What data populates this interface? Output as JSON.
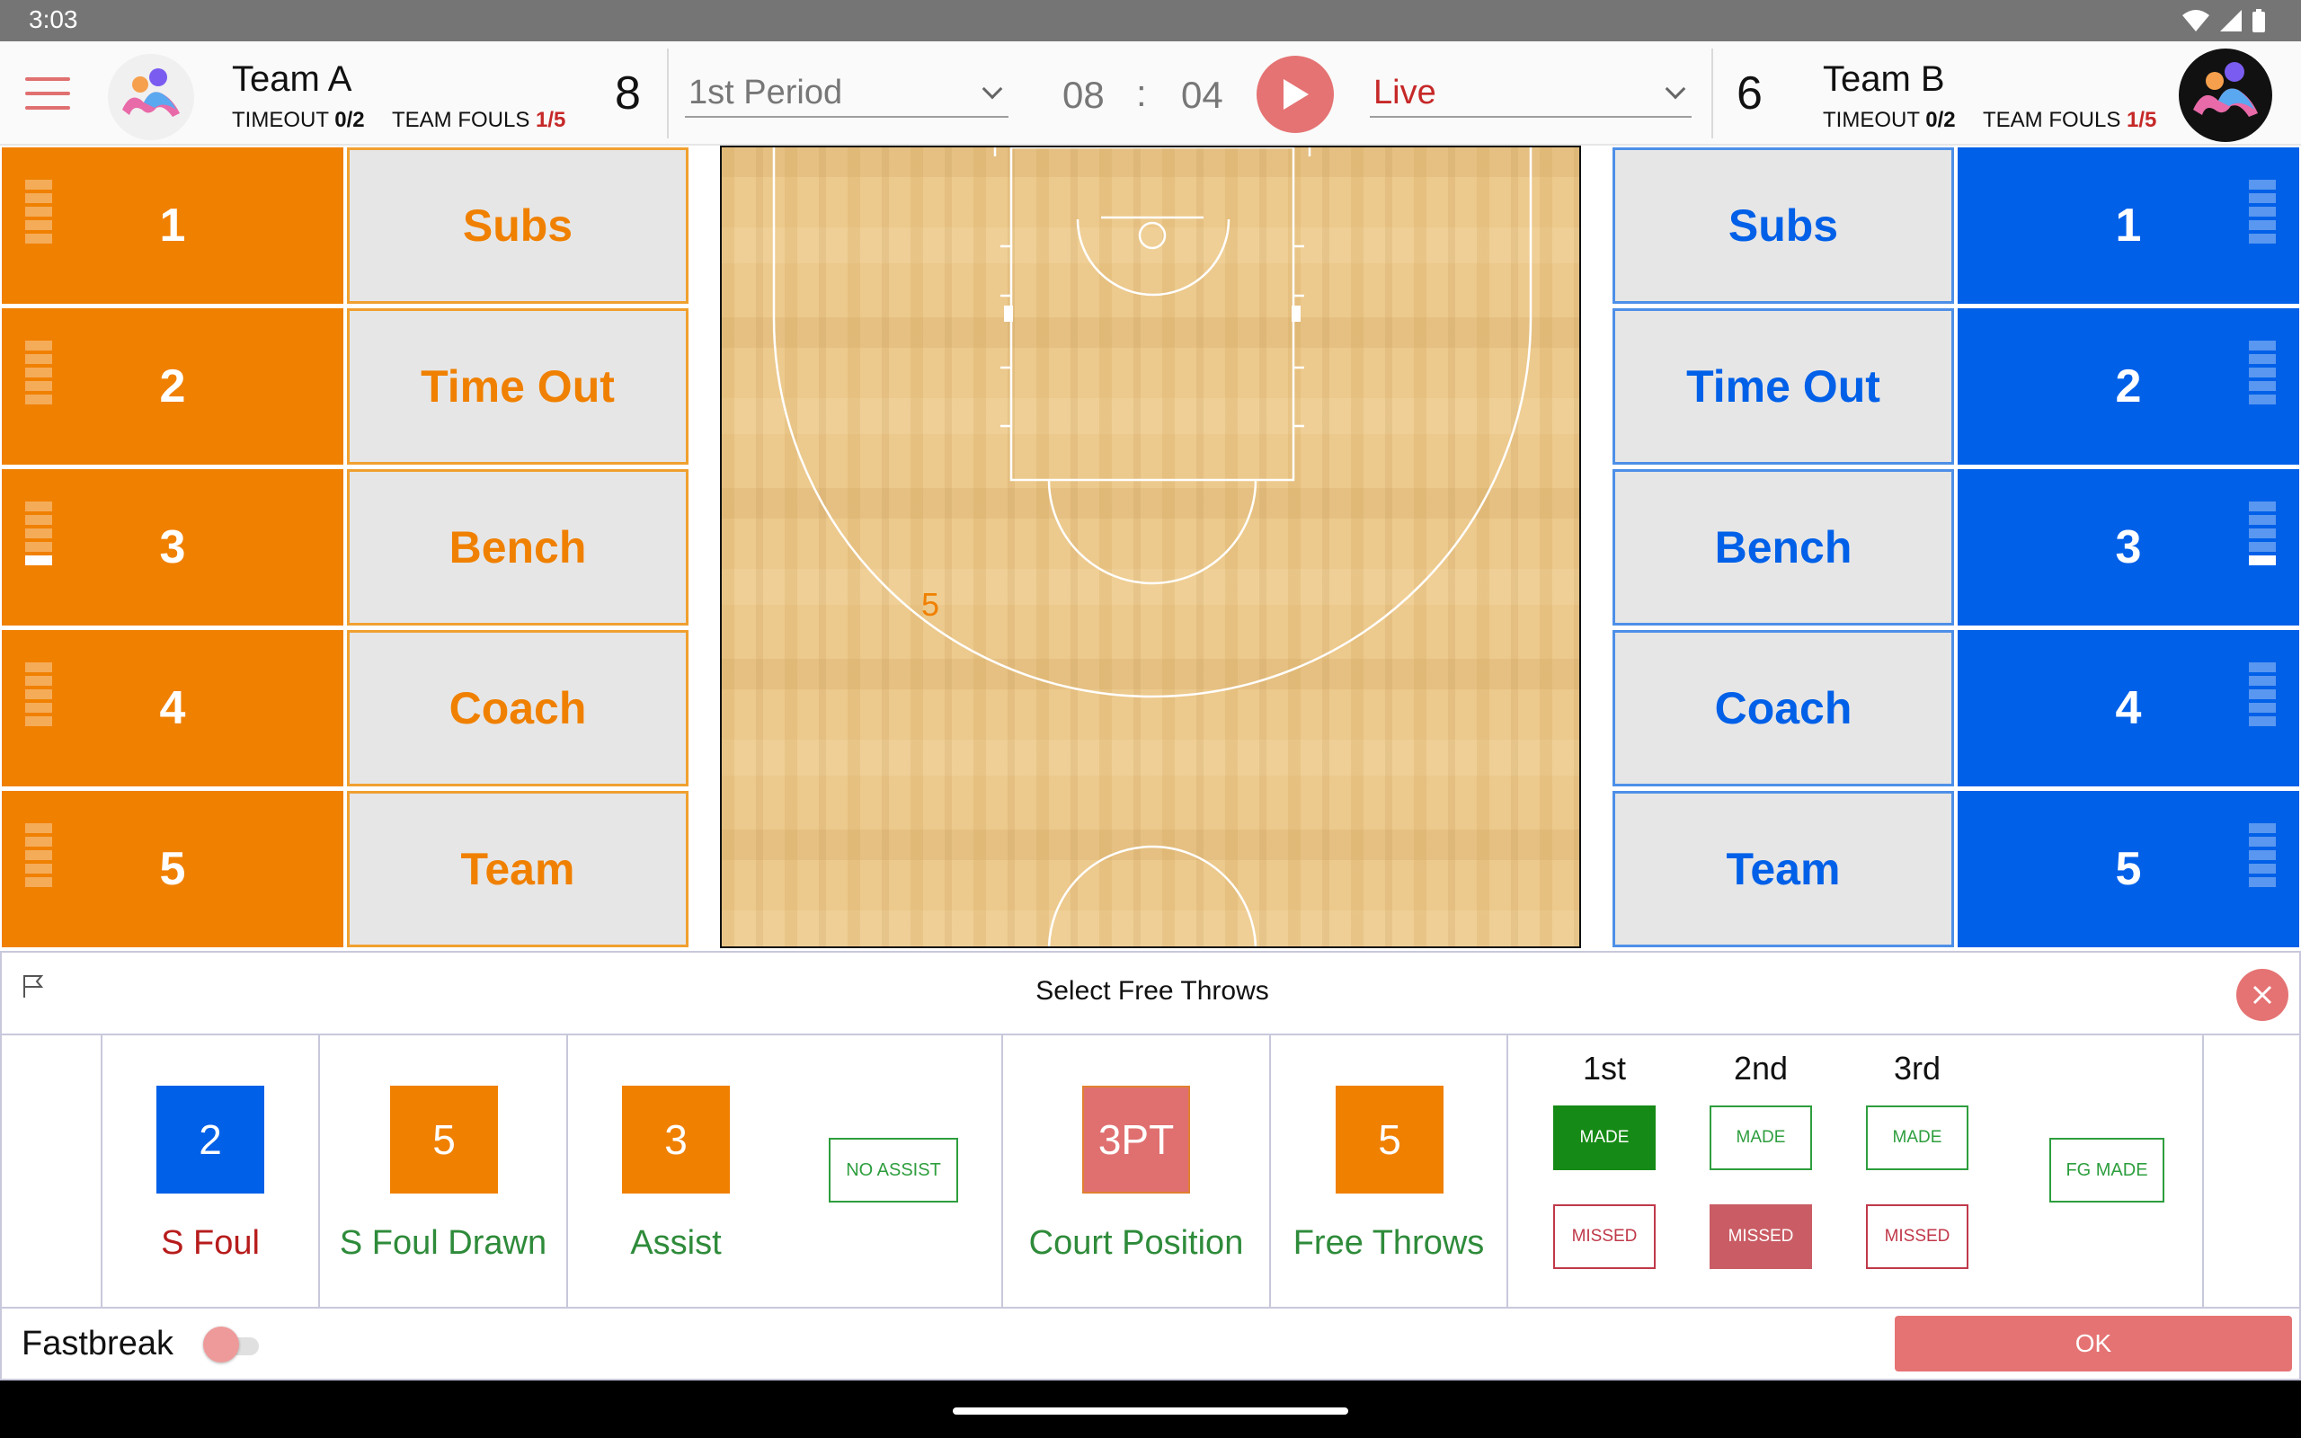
{
  "status": {
    "time": "3:03"
  },
  "header": {
    "team_a": {
      "name": "Team A",
      "timeout_label": "TIMEOUT",
      "timeout_value": "0/2",
      "fouls_label": "TEAM FOULS",
      "fouls_value": "1/5",
      "score": "8"
    },
    "team_b": {
      "name": "Team B",
      "timeout_label": "TIMEOUT",
      "timeout_value": "0/2",
      "fouls_label": "TEAM FOULS",
      "fouls_value": "1/5",
      "score": "6"
    },
    "period": "1st Period",
    "clock": {
      "minutes": "08",
      "separator": ":",
      "seconds": "04"
    },
    "mode": "Live"
  },
  "colors": {
    "team_a": "#f08000",
    "team_b": "#0060e8",
    "accent": "#e57373"
  },
  "team_a_players": [
    {
      "number": "1",
      "fouls": 0
    },
    {
      "number": "2",
      "fouls": 0
    },
    {
      "number": "3",
      "fouls": 1
    },
    {
      "number": "4",
      "fouls": 0
    },
    {
      "number": "5",
      "fouls": 0
    }
  ],
  "team_b_players": [
    {
      "number": "1",
      "fouls": 0
    },
    {
      "number": "2",
      "fouls": 0
    },
    {
      "number": "3",
      "fouls": 1
    },
    {
      "number": "4",
      "fouls": 0
    },
    {
      "number": "5",
      "fouls": 0
    }
  ],
  "team_a_actions": [
    "Subs",
    "Time Out",
    "Bench",
    "Coach",
    "Team"
  ],
  "team_b_actions": [
    "Subs",
    "Time Out",
    "Bench",
    "Coach",
    "Team"
  ],
  "court": {
    "marker": "5"
  },
  "panel": {
    "title": "Select Free Throws",
    "slots": {
      "s_foul": {
        "value": "2",
        "label": "S Foul"
      },
      "s_foul_drawn": {
        "value": "5",
        "label": "S Foul Drawn"
      },
      "assist": {
        "value": "3",
        "label": "Assist"
      },
      "no_assist": "NO ASSIST",
      "court_position": {
        "value": "3PT",
        "label": "Court Position"
      },
      "free_throws": {
        "value": "5",
        "label": "Free Throws"
      }
    },
    "ft": {
      "headers": [
        "1st",
        "2nd",
        "3rd"
      ],
      "made": "MADE",
      "missed": "MISSED",
      "results": [
        "made",
        "missed",
        "none"
      ]
    },
    "fg_made": "FG MADE",
    "fastbreak": {
      "label": "Fastbreak",
      "on": false
    },
    "ok": "OK"
  }
}
